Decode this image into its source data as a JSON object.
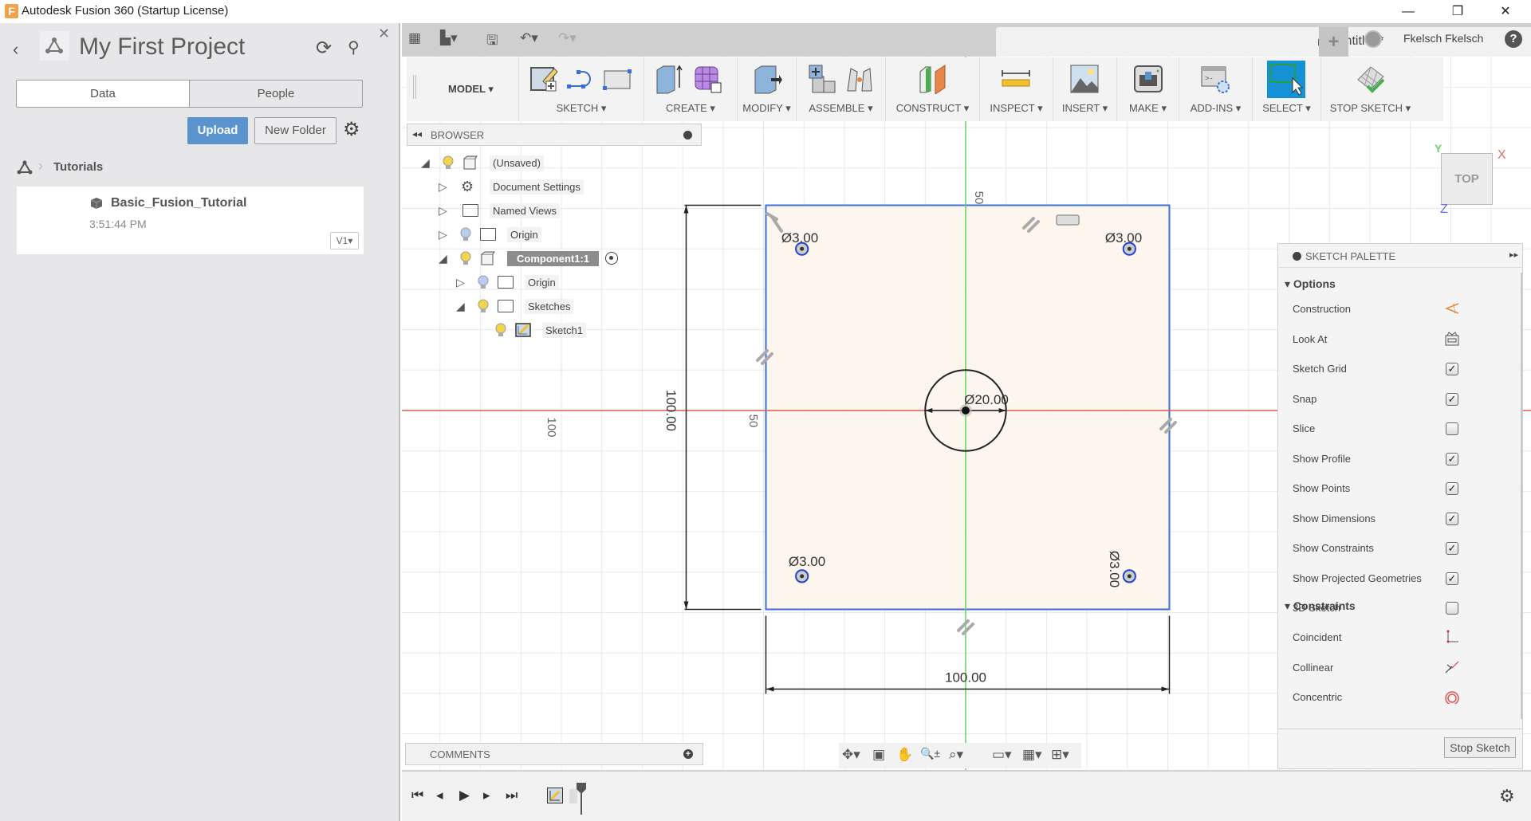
{
  "window": {
    "app_icon_letter": "F",
    "title": "Autodesk Fusion 360 (Startup License)",
    "minimize": "—",
    "restore": "❐",
    "close": "✕"
  },
  "data_panel": {
    "back_icon": "‹",
    "project_title": "My First Project",
    "refresh_icon": "⟳",
    "search_icon": "⚲",
    "close_icon": "✕",
    "tabs": [
      {
        "label": "Data",
        "active": true
      },
      {
        "label": "People",
        "active": false
      }
    ],
    "upload_label": "Upload",
    "new_folder_label": "New Folder",
    "settings_icon": "⚙",
    "breadcrumb": {
      "separator": "›",
      "folder": "Tutorials"
    },
    "files": [
      {
        "name": "Basic_Fusion_Tutorial",
        "time": "3:51:44 PM",
        "version": "V1▾"
      }
    ]
  },
  "quick_access": {
    "grid_icon": "▦",
    "file_icon": "▙▾",
    "save_icon": "🖫",
    "undo_icon": "↶▾",
    "redo_icon": "↷▾"
  },
  "document_tab": {
    "title": "Untitled*",
    "close_icon": "×",
    "new_tab_icon": "+",
    "user_name": "Fkelsch Fkelsch",
    "help_icon": "?"
  },
  "toolbar": {
    "workspace": "MODEL ▾",
    "groups": [
      {
        "label": "SKETCH ▾"
      },
      {
        "label": "CREATE ▾"
      },
      {
        "label": "MODIFY ▾"
      },
      {
        "label": "ASSEMBLE ▾"
      },
      {
        "label": "CONSTRUCT ▾"
      },
      {
        "label": "INSPECT ▾"
      },
      {
        "label": "INSERT ▾"
      },
      {
        "label": "MAKE ▾"
      },
      {
        "label": "ADD-INS ▾"
      },
      {
        "label": "SELECT ▾"
      },
      {
        "label": "STOP SKETCH ▾"
      }
    ]
  },
  "browser": {
    "title": "BROWSER",
    "collapse_icon": "◂◂",
    "tree": [
      {
        "label": "(Unsaved)",
        "expanded": true,
        "level": 0,
        "bulb": "on",
        "icon": "component"
      },
      {
        "label": "Document Settings",
        "expanded": false,
        "level": 1,
        "bulb": "none",
        "icon": "gear"
      },
      {
        "label": "Named Views",
        "expanded": false,
        "level": 1,
        "bulb": "none",
        "icon": "folder"
      },
      {
        "label": "Origin",
        "expanded": false,
        "level": 1,
        "bulb": "off",
        "icon": "folder"
      },
      {
        "label": "Component1:1",
        "expanded": true,
        "level": 1,
        "bulb": "on",
        "icon": "component",
        "active": true
      },
      {
        "label": "Origin",
        "expanded": false,
        "level": 2,
        "bulb": "off",
        "icon": "folder"
      },
      {
        "label": "Sketches",
        "expanded": true,
        "level": 2,
        "bulb": "on",
        "icon": "folder"
      },
      {
        "label": "Sketch1",
        "expanded": null,
        "level": 3,
        "bulb": "on",
        "icon": "sketch"
      }
    ]
  },
  "sketch": {
    "rect_width_dim": "100.00",
    "rect_height_dim": "100.00",
    "center_circle_dim": "Ø20.00",
    "hole_dims": [
      "Ø3.00",
      "Ø3.00",
      "Ø3.00",
      "Ø3.00"
    ],
    "grid_labels": {
      "top": "50",
      "left_near": "50",
      "left_far": "100"
    },
    "colors": {
      "profile_fill": "#fdf5ec",
      "rect_stroke": "#3a6fd8",
      "x_axis": "#e05a4e",
      "y_axis": "#5fd35f",
      "grid": "#e8e8e8"
    }
  },
  "viewcube": {
    "face": "TOP",
    "x": "X",
    "y": "Y",
    "z": "Z"
  },
  "sketch_palette": {
    "title": "SKETCH PALETTE",
    "expand_icon": "▸▸",
    "options_header": "▾ Options",
    "options": [
      {
        "label": "Construction",
        "type": "icon",
        "icon": "construction-icon"
      },
      {
        "label": "Look At",
        "type": "icon",
        "icon": "look-at-icon"
      },
      {
        "label": "Sketch Grid",
        "type": "checkbox",
        "checked": true
      },
      {
        "label": "Snap",
        "type": "checkbox",
        "checked": true
      },
      {
        "label": "Slice",
        "type": "checkbox",
        "checked": false
      },
      {
        "label": "Show Profile",
        "type": "checkbox",
        "checked": true
      },
      {
        "label": "Show Points",
        "type": "checkbox",
        "checked": true
      },
      {
        "label": "Show Dimensions",
        "type": "checkbox",
        "checked": true
      },
      {
        "label": "Show Constraints",
        "type": "checkbox",
        "checked": true
      },
      {
        "label": "Show Projected Geometries",
        "type": "checkbox",
        "checked": true
      },
      {
        "label": "3D Sketch",
        "type": "checkbox",
        "checked": false
      }
    ],
    "constraints_header": "▾ Constraints",
    "constraints": [
      {
        "label": "Coincident",
        "icon": "coincident-icon"
      },
      {
        "label": "Collinear",
        "icon": "collinear-icon"
      },
      {
        "label": "Concentric",
        "icon": "concentric-icon"
      }
    ],
    "stop_sketch_label": "Stop Sketch"
  },
  "comments": {
    "title": "COMMENTS",
    "add_icon": "+"
  },
  "nav_bar": {
    "orbit": "✥▾",
    "look_at": "▣",
    "pan": "✋",
    "zoom": "🔍±",
    "fit": "⌕▾",
    "display": "▭▾",
    "grid": "▦▾",
    "viewports": "⊞▾"
  },
  "timeline": {
    "first": "⏮",
    "prev": "◂",
    "play": "▶",
    "next": "▸",
    "last": "⏭",
    "settings_icon": "⚙"
  }
}
